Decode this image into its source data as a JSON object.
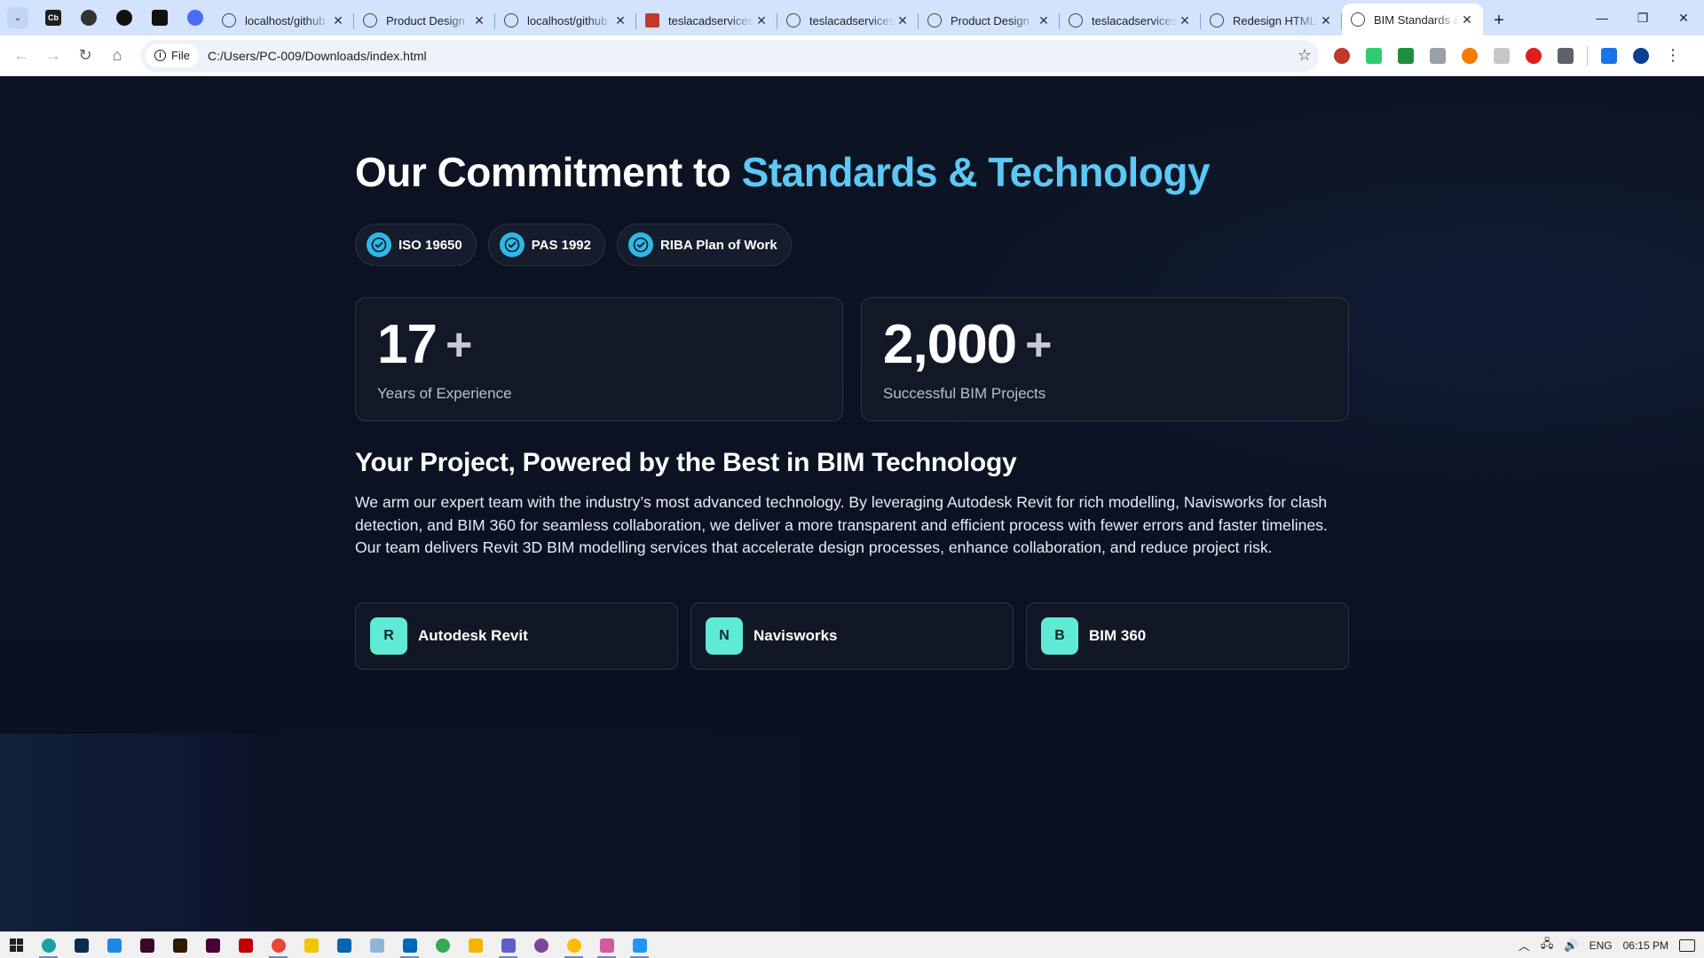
{
  "browser": {
    "pinned_tabs": [
      {
        "icon": "cb-icon",
        "text": "Cb",
        "color": "#1f1f1f"
      },
      {
        "icon": "panda-icon",
        "text": "",
        "color": "#333333"
      },
      {
        "icon": "puzzle-ball-icon",
        "text": "",
        "color": "#111111"
      },
      {
        "icon": "app-square-icon",
        "text": "",
        "color": "#111111"
      },
      {
        "icon": "bird-icon",
        "text": "",
        "color": "#4a6cf7"
      }
    ],
    "tabs": [
      {
        "title": "localhost/github",
        "favicon": "globe-icon",
        "active": false
      },
      {
        "title": "Product Design",
        "favicon": "globe-icon",
        "active": false
      },
      {
        "title": "localhost/github",
        "favicon": "globe-icon",
        "active": false
      },
      {
        "title": "teslacadservices",
        "favicon": "tesla-icon",
        "active": false
      },
      {
        "title": "teslacadservices",
        "favicon": "globe-icon",
        "active": false
      },
      {
        "title": "Product Design",
        "favicon": "globe-icon",
        "active": false
      },
      {
        "title": "teslacadservices",
        "favicon": "globe-icon",
        "active": false
      },
      {
        "title": "Redesign HTML",
        "favicon": "globe-icon",
        "active": false
      },
      {
        "title": "BIM Standards &",
        "favicon": "globe-icon",
        "active": true
      }
    ],
    "chip_label": "File",
    "url": "C:/Users/PC-009/Downloads/index.html"
  },
  "page": {
    "heading_prefix": "Our Commitment to ",
    "heading_accent": "Standards & Technology",
    "badges": [
      "ISO 19650",
      "PAS 1992",
      "RIBA Plan of Work"
    ],
    "stats": [
      {
        "number": "17",
        "suffix": "+",
        "label": "Years of Experience"
      },
      {
        "number": "2,000",
        "suffix": "+",
        "label": "Successful BIM Projects"
      }
    ],
    "subheading": "Your Project, Powered by the Best in BIM Technology",
    "paragraph": "We arm our expert team with the industry’s most advanced technology. By leveraging Autodesk Revit for rich modelling, Navisworks for clash detection, and BIM 360 for seamless collaboration, we deliver a more transparent and efficient process with fewer errors and faster timelines. Our team delivers Revit 3D BIM modelling services that accelerate design processes, enhance collaboration, and reduce project risk.",
    "tools": [
      {
        "letter": "R",
        "name": "Autodesk Revit"
      },
      {
        "letter": "N",
        "name": "Navisworks"
      },
      {
        "letter": "B",
        "name": "BIM 360"
      }
    ],
    "colors": {
      "accent": "#5cc8f5",
      "tool_tile": "#5eead4",
      "check": "#2fb8e6",
      "background": "#0a1022"
    }
  },
  "taskbar": {
    "language": "ENG",
    "time": "06:15 PM"
  }
}
